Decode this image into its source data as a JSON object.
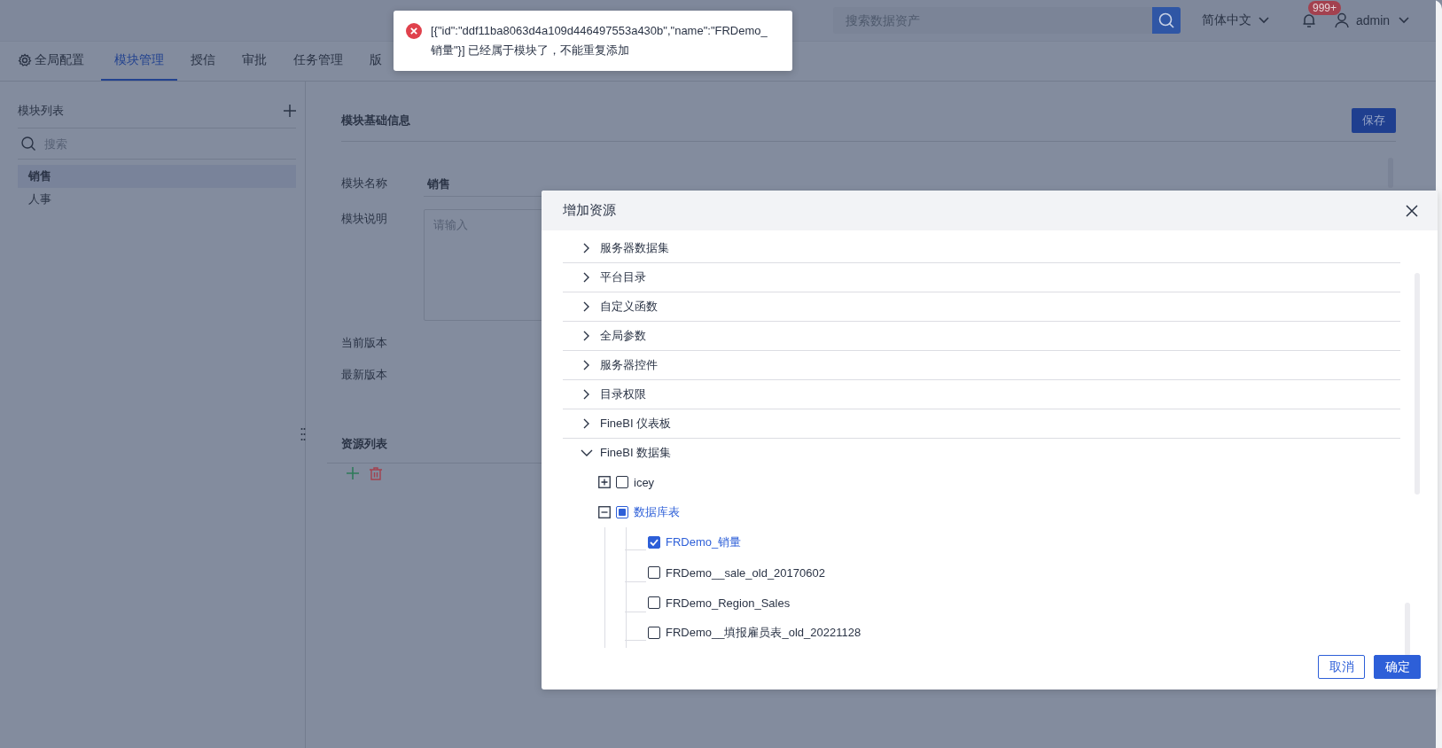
{
  "header": {
    "search": {
      "placeholder": "搜索数据资产"
    },
    "language": "简体中文",
    "notifications": {
      "badge": "999+"
    },
    "user": "admin"
  },
  "tabs": [
    {
      "label": "全局配置",
      "kind": "settings",
      "selected": false
    },
    {
      "label": "模块管理",
      "kind": "plain",
      "selected": true
    },
    {
      "label": "授信",
      "kind": "plain",
      "selected": false
    },
    {
      "label": "审批",
      "kind": "plain",
      "selected": false
    },
    {
      "label": "任务管理",
      "kind": "plain",
      "selected": false
    },
    {
      "label": "版",
      "kind": "plain",
      "selected": false
    }
  ],
  "sidebar": {
    "title": "模块列表",
    "search": {
      "placeholder": "搜索"
    },
    "items": [
      {
        "label": "销售",
        "selected": true
      },
      {
        "label": "人事",
        "selected": false
      }
    ]
  },
  "main": {
    "section_title": "模块基础信息",
    "save_button": "保存",
    "fields": [
      {
        "kind": "input",
        "label": "模块名称",
        "value": "销售"
      },
      {
        "kind": "textarea",
        "label": "模块说明",
        "placeholder": "请输入"
      },
      {
        "kind": "text",
        "label": "当前版本"
      },
      {
        "kind": "text",
        "label": "最新版本"
      }
    ],
    "resources_title": "资源列表"
  },
  "dialog": {
    "title": "增加资源",
    "tree": [
      {
        "label": "服务器数据集",
        "expanded": false
      },
      {
        "label": "平台目录",
        "expanded": false
      },
      {
        "label": "自定义函数",
        "expanded": false
      },
      {
        "label": "全局参数",
        "expanded": false
      },
      {
        "label": "服务器控件",
        "expanded": false
      },
      {
        "label": "目录权限",
        "expanded": false
      },
      {
        "label": "FineBI 仪表板",
        "expanded": false
      },
      {
        "label": "FineBI 数据集",
        "expanded": true,
        "children": [
          {
            "label": "icey",
            "expanded": false,
            "checked": false,
            "indeterminate": false
          },
          {
            "label": "数据库表",
            "expanded": true,
            "checked": false,
            "indeterminate": true,
            "children": [
              {
                "label": "FRDemo_销量",
                "checked": true
              },
              {
                "label": "FRDemo__sale_old_20170602",
                "checked": false
              },
              {
                "label": "FRDemo_Region_Sales",
                "checked": false
              },
              {
                "label": "FRDemo__填报雇员表_old_20221128",
                "checked": false
              }
            ]
          }
        ]
      }
    ],
    "buttons": [
      {
        "label": "取消",
        "kind": "secondary"
      },
      {
        "label": "确定",
        "kind": "primary"
      }
    ]
  },
  "toast": {
    "kind": "error",
    "message": "[{\"id\":\"ddf11ba8063d4a109d446497553a430b\",\"name\":\"FRDemo_销量\"}] 已经属于模块了，不能重复添加"
  }
}
